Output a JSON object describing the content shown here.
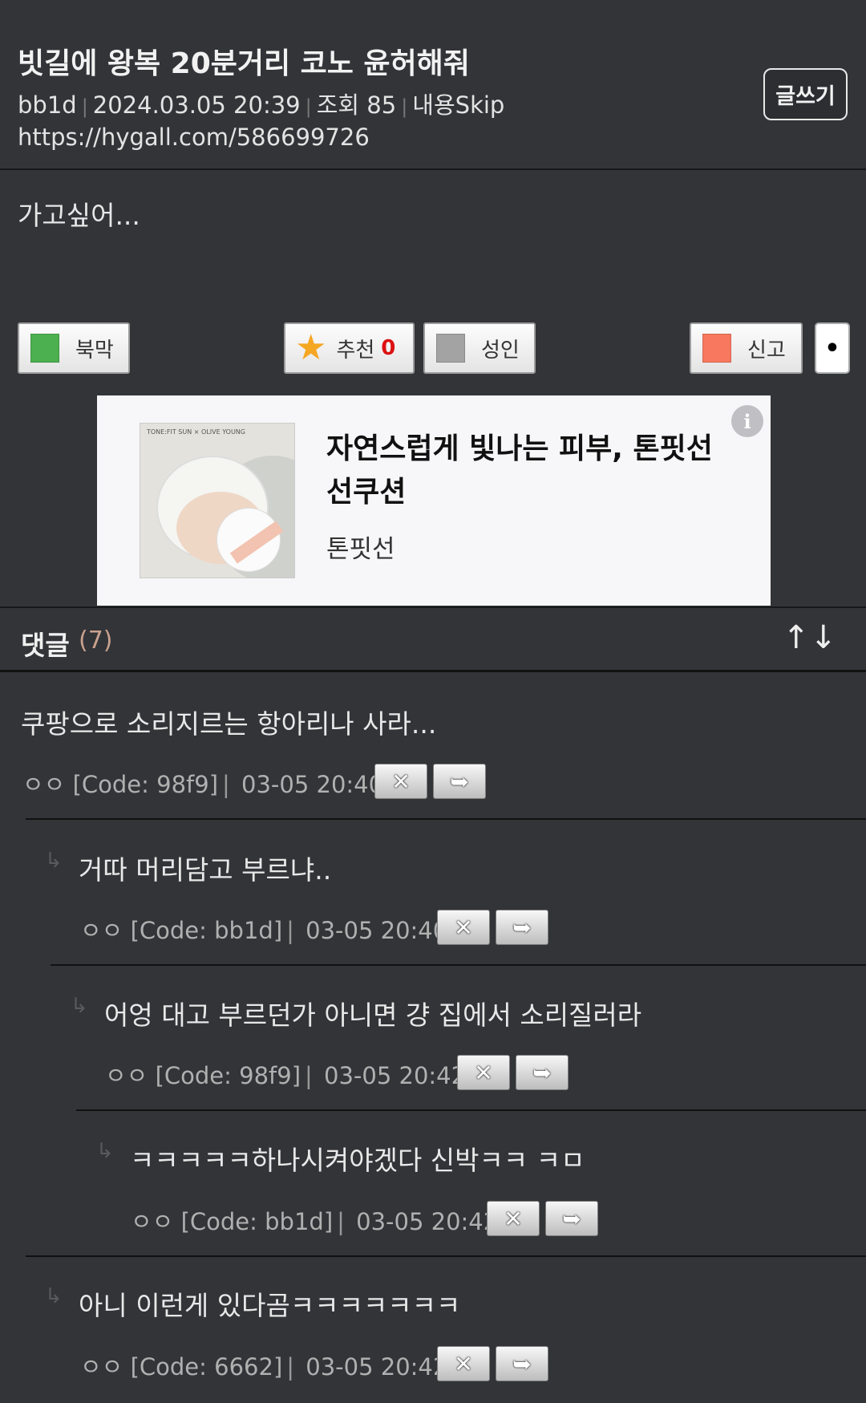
{
  "post": {
    "title": "빗길에 왕복 20분거리 코노 윤허해줘",
    "author": "bb1d",
    "datetime": "2024.03.05 20:39",
    "views": "조회 85",
    "skip_link": "내용Skip",
    "url": "https://hygall.com/586699726",
    "write_button": "글쓰기",
    "body": "가고싶어..."
  },
  "actions": {
    "bookmark": "북막",
    "recommend": "추천",
    "recommend_count": "0",
    "adult": "성인",
    "report": "신고",
    "more": "•"
  },
  "ad": {
    "image_brand_text": "TONE:FIT SUN × OLIVE YOUNG",
    "title": "자연스럽게 빛나는 피부, 톤핏선 선쿠션",
    "subtitle": "톤핏선",
    "info": "i"
  },
  "comments_header": {
    "label": "댓글",
    "count": "(7)",
    "up": "↑",
    "down": "↓"
  },
  "comments": [
    {
      "text": "쿠팡으로 소리지르는 항아리나 사라...",
      "name": "ㅇㅇ",
      "code": "[Code: 98f9]",
      "time": "03-05 20:40"
    },
    {
      "text": "거따 머리담고 부르냐..",
      "name": "ㅇㅇ",
      "code": "[Code: bb1d]",
      "time": "03-05 20:40"
    },
    {
      "text": "어엉 대고 부르던가 아니면 걍 집에서 소리질러라",
      "name": "ㅇㅇ",
      "code": "[Code: 98f9]",
      "time": "03-05 20:42"
    },
    {
      "text": "ㅋㅋㅋㅋㅋ하나시켜야겠다 신박ㅋㅋ ㅋㅁ",
      "name": "ㅇㅇ",
      "code": "[Code: bb1d]",
      "time": "03-05 20:42"
    },
    {
      "text": "아니 이런게 있다곰ㅋㅋㅋㅋㅋㅋㅋ",
      "name": "ㅇㅇ",
      "code": "[Code: 6662]",
      "time": "03-05 20:42"
    }
  ],
  "icons": {
    "delete": "✕",
    "reply": "➥",
    "reply_marker": "↳"
  }
}
